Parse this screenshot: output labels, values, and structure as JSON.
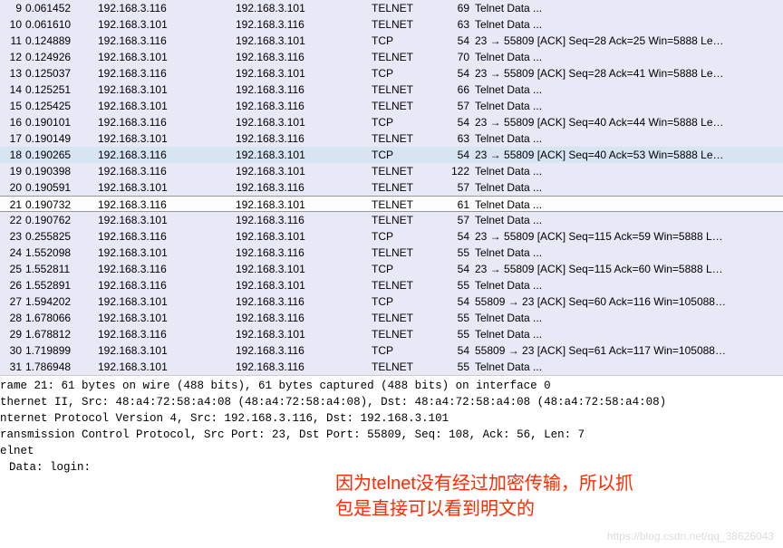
{
  "packets": [
    {
      "no": 9,
      "time": "0.061452",
      "src": "192.168.3.116",
      "dst": "192.168.3.101",
      "proto": "TELNET",
      "len": 69,
      "info": "Telnet Data ...",
      "tint": true
    },
    {
      "no": 10,
      "time": "0.061610",
      "src": "192.168.3.101",
      "dst": "192.168.3.116",
      "proto": "TELNET",
      "len": 63,
      "info": "Telnet Data ...",
      "tint": true
    },
    {
      "no": 11,
      "time": "0.124889",
      "src": "192.168.3.116",
      "dst": "192.168.3.101",
      "proto": "TCP",
      "len": 54,
      "info": "23 → 55809 [ACK] Seq=28 Ack=25 Win=5888 Le…",
      "tint": true
    },
    {
      "no": 12,
      "time": "0.124926",
      "src": "192.168.3.101",
      "dst": "192.168.3.116",
      "proto": "TELNET",
      "len": 70,
      "info": "Telnet Data ...",
      "tint": true
    },
    {
      "no": 13,
      "time": "0.125037",
      "src": "192.168.3.116",
      "dst": "192.168.3.101",
      "proto": "TCP",
      "len": 54,
      "info": "23 → 55809 [ACK] Seq=28 Ack=41 Win=5888 Le…",
      "tint": true
    },
    {
      "no": 14,
      "time": "0.125251",
      "src": "192.168.3.101",
      "dst": "192.168.3.116",
      "proto": "TELNET",
      "len": 66,
      "info": "Telnet Data ...",
      "tint": true
    },
    {
      "no": 15,
      "time": "0.125425",
      "src": "192.168.3.101",
      "dst": "192.168.3.116",
      "proto": "TELNET",
      "len": 57,
      "info": "Telnet Data ...",
      "tint": true
    },
    {
      "no": 16,
      "time": "0.190101",
      "src": "192.168.3.116",
      "dst": "192.168.3.101",
      "proto": "TCP",
      "len": 54,
      "info": "23 → 55809 [ACK] Seq=40 Ack=44 Win=5888 Le…",
      "tint": true
    },
    {
      "no": 17,
      "time": "0.190149",
      "src": "192.168.3.101",
      "dst": "192.168.3.116",
      "proto": "TELNET",
      "len": 63,
      "info": "Telnet Data ...",
      "tint": true
    },
    {
      "no": 18,
      "time": "0.190265",
      "src": "192.168.3.116",
      "dst": "192.168.3.101",
      "proto": "TCP",
      "len": 54,
      "info": "23 → 55809 [ACK] Seq=40 Ack=53 Win=5888 Le…",
      "tint": true,
      "selected": true
    },
    {
      "no": 19,
      "time": "0.190398",
      "src": "192.168.3.116",
      "dst": "192.168.3.101",
      "proto": "TELNET",
      "len": 122,
      "info": "Telnet Data ...",
      "tint": true
    },
    {
      "no": 20,
      "time": "0.190591",
      "src": "192.168.3.101",
      "dst": "192.168.3.116",
      "proto": "TELNET",
      "len": 57,
      "info": "Telnet Data ...",
      "tint": true
    },
    {
      "no": 21,
      "time": "0.190732",
      "src": "192.168.3.116",
      "dst": "192.168.3.101",
      "proto": "TELNET",
      "len": 61,
      "info": "Telnet Data ...",
      "current": true
    },
    {
      "no": 22,
      "time": "0.190762",
      "src": "192.168.3.101",
      "dst": "192.168.3.116",
      "proto": "TELNET",
      "len": 57,
      "info": "Telnet Data ...",
      "tint": true
    },
    {
      "no": 23,
      "time": "0.255825",
      "src": "192.168.3.116",
      "dst": "192.168.3.101",
      "proto": "TCP",
      "len": 54,
      "info": "23 → 55809 [ACK] Seq=115 Ack=59 Win=5888 L…",
      "tint": true
    },
    {
      "no": 24,
      "time": "1.552098",
      "src": "192.168.3.101",
      "dst": "192.168.3.116",
      "proto": "TELNET",
      "len": 55,
      "info": "Telnet Data ...",
      "tint": true
    },
    {
      "no": 25,
      "time": "1.552811",
      "src": "192.168.3.116",
      "dst": "192.168.3.101",
      "proto": "TCP",
      "len": 54,
      "info": "23 → 55809 [ACK] Seq=115 Ack=60 Win=5888 L…",
      "tint": true
    },
    {
      "no": 26,
      "time": "1.552891",
      "src": "192.168.3.116",
      "dst": "192.168.3.101",
      "proto": "TELNET",
      "len": 55,
      "info": "Telnet Data ...",
      "tint": true
    },
    {
      "no": 27,
      "time": "1.594202",
      "src": "192.168.3.101",
      "dst": "192.168.3.116",
      "proto": "TCP",
      "len": 54,
      "info": "55809 → 23 [ACK] Seq=60 Ack=116 Win=105088…",
      "tint": true
    },
    {
      "no": 28,
      "time": "1.678066",
      "src": "192.168.3.101",
      "dst": "192.168.3.116",
      "proto": "TELNET",
      "len": 55,
      "info": "Telnet Data ...",
      "tint": true
    },
    {
      "no": 29,
      "time": "1.678812",
      "src": "192.168.3.116",
      "dst": "192.168.3.101",
      "proto": "TELNET",
      "len": 55,
      "info": "Telnet Data ...",
      "tint": true
    },
    {
      "no": 30,
      "time": "1.719899",
      "src": "192.168.3.101",
      "dst": "192.168.3.116",
      "proto": "TCP",
      "len": 54,
      "info": "55809 → 23 [ACK] Seq=61 Ack=117 Win=105088…",
      "tint": true
    },
    {
      "no": 31,
      "time": "1.786948",
      "src": "192.168.3.101",
      "dst": "192.168.3.116",
      "proto": "TELNET",
      "len": 55,
      "info": "Telnet Data ...",
      "tint": true
    }
  ],
  "details": {
    "frame": "rame 21: 61 bytes on wire (488 bits), 61 bytes captured (488 bits) on interface 0",
    "eth": "thernet II, Src: 48:a4:72:58:a4:08 (48:a4:72:58:a4:08), Dst: 48:a4:72:58:a4:08 (48:a4:72:58:a4:08)",
    "ip": "nternet Protocol Version 4, Src: 192.168.3.116, Dst: 192.168.3.101",
    "tcp": "ransmission Control Protocol, Src Port: 23, Dst Port: 55809, Seq: 108, Ack: 56, Len: 7",
    "telnet": "elnet",
    "data": "Data: login:"
  },
  "annotation": {
    "line1": "因为telnet没有经过加密传输，所以抓",
    "line2": "包是直接可以看到明文的"
  },
  "watermark": "https://blog.csdn.net/qq_38626043"
}
